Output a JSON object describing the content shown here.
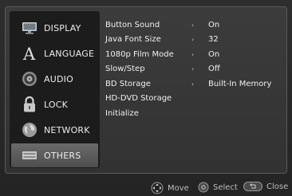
{
  "sidebar": {
    "items": [
      {
        "label": "DISPLAY",
        "icon": "monitor-icon"
      },
      {
        "label": "LANGUAGE",
        "icon": "letter-a-icon"
      },
      {
        "label": "AUDIO",
        "icon": "speaker-icon"
      },
      {
        "label": "LOCK",
        "icon": "padlock-icon"
      },
      {
        "label": "NETWORK",
        "icon": "globe-icon"
      },
      {
        "label": "OTHERS",
        "icon": "device-icon"
      }
    ],
    "selected": "OTHERS"
  },
  "settings": {
    "rows": [
      {
        "name": "Button Sound",
        "arrow": "›",
        "value": "On"
      },
      {
        "name": "Java Font Size",
        "arrow": "›",
        "value": "32"
      },
      {
        "name": "1080p Film Mode",
        "arrow": "›",
        "value": "On"
      },
      {
        "name": "Slow/Step",
        "arrow": "›",
        "value": "Off"
      },
      {
        "name": "BD Storage",
        "arrow": "›",
        "value": "Built-In Memory"
      },
      {
        "name": "HD-DVD Storage",
        "arrow": "",
        "value": ""
      },
      {
        "name": "Initialize",
        "arrow": "",
        "value": ""
      }
    ]
  },
  "footer": {
    "move_label": "Move",
    "select_label": "Select",
    "close_label": "Close"
  },
  "colors": {
    "background": "#2e2e2e",
    "sidebar": "#1c1c1c",
    "selected": "#5e5e5e",
    "text": "#f0f0f0"
  }
}
